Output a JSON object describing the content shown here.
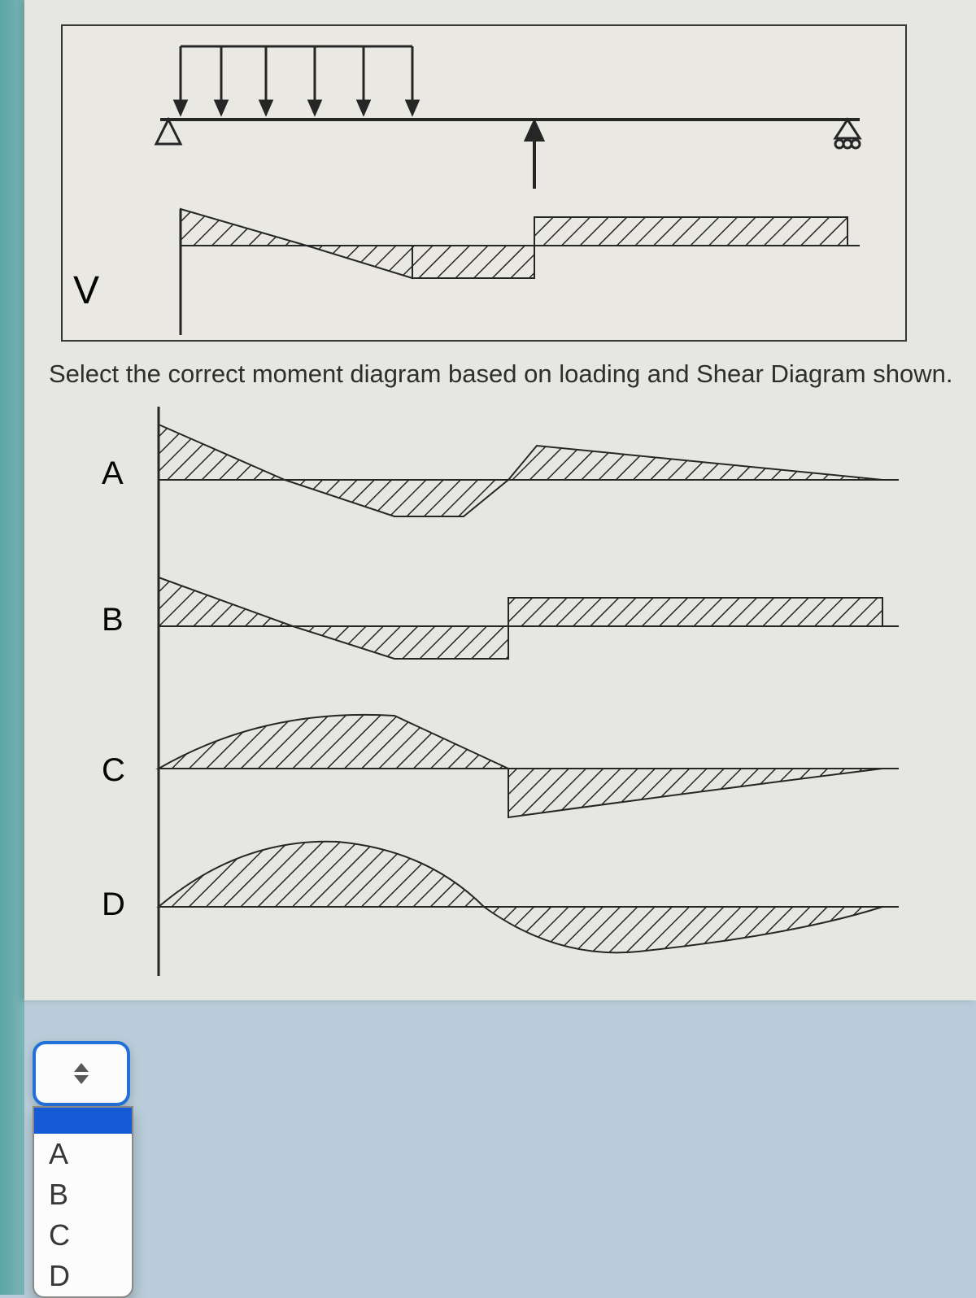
{
  "diagram": {
    "v_label": "V",
    "question": "Select the correct moment diagram based on loading and Shear Diagram shown.",
    "options": {
      "a": "A",
      "b": "B",
      "c": "C",
      "d": "D"
    }
  },
  "dropdown": {
    "selected": "",
    "items": [
      "A",
      "B",
      "C",
      "D"
    ]
  }
}
